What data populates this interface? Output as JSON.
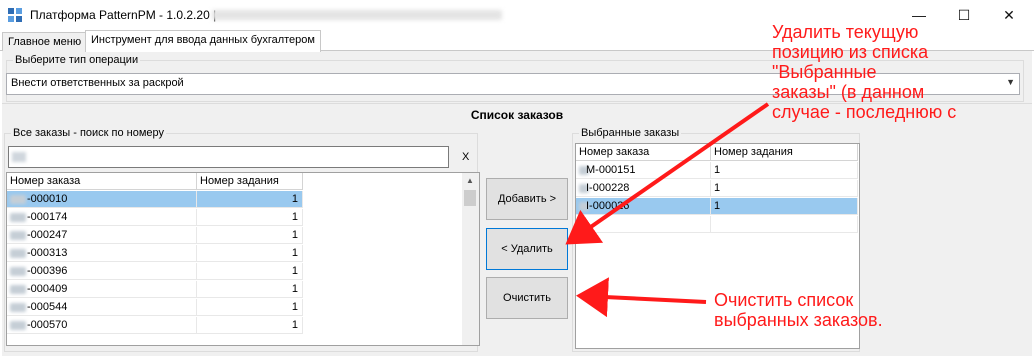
{
  "window": {
    "title": "Платформа PatternPM - 1.0.2.20 |",
    "minimize": "—",
    "maximize": "☐",
    "close": "✕"
  },
  "tabs": [
    {
      "label": "Главное меню"
    },
    {
      "label": "Инструмент для ввода данных бухгалтером"
    }
  ],
  "operation": {
    "label": "Выберите тип операции",
    "value": "Внести ответственных за раскрой"
  },
  "orders_header": "Список заказов",
  "all_orders": {
    "group_title": "Все заказы - поиск по номеру",
    "clear_label": "X",
    "columns": [
      "Номер заказа",
      "Номер задания"
    ],
    "rows": [
      {
        "order": "-000010",
        "task": "1"
      },
      {
        "order": "-000174",
        "task": "1"
      },
      {
        "order": "-000247",
        "task": "1"
      },
      {
        "order": "-000313",
        "task": "1"
      },
      {
        "order": "-000396",
        "task": "1"
      },
      {
        "order": "-000409",
        "task": "1"
      },
      {
        "order": "-000544",
        "task": "1"
      },
      {
        "order": "-000570",
        "task": "1"
      }
    ]
  },
  "buttons": {
    "add": "Добавить >",
    "remove": "< Удалить",
    "clear": "Очистить"
  },
  "selected_orders": {
    "group_title": "Выбранные заказы",
    "columns": [
      "Номер заказа",
      "Номер задания"
    ],
    "rows": [
      {
        "order": "M-000151",
        "task": "1"
      },
      {
        "order": "I-000228",
        "task": "1"
      },
      {
        "order": "I-000026",
        "task": "1"
      }
    ]
  },
  "annotations": {
    "remove_note": [
      "Удалить текущую",
      "позицию из списка",
      "\"Выбранные",
      "заказы\" (в данном",
      "случае - последнюю с"
    ],
    "clear_note": [
      "Очистить список",
      "выбранных заказов."
    ]
  },
  "colors": {
    "selection": "#99c9ef",
    "annotation": "#ff1a1a",
    "focus": "#0078d7"
  }
}
